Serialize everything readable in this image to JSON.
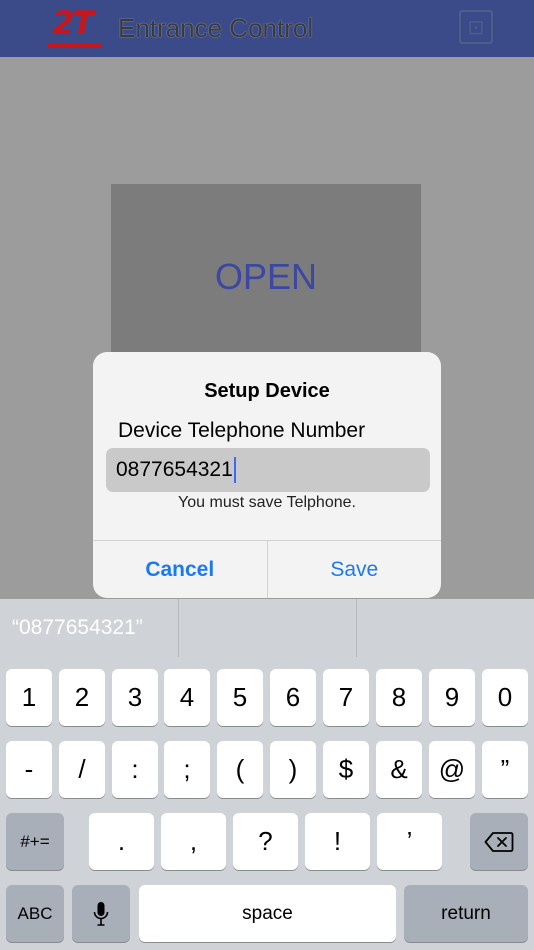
{
  "header": {
    "logo_text": "2T",
    "title": "Entrance Control",
    "settings_icon": "settings-icon"
  },
  "main": {
    "open_label": "OPEN"
  },
  "dialog": {
    "title": "Setup Device",
    "field_label": "Device Telephone Number",
    "field_value": "0877654321",
    "hint": "You must save Telphone.",
    "cancel_label": "Cancel",
    "save_label": "Save"
  },
  "keyboard": {
    "suggestions": [
      "“0877654321”",
      "",
      ""
    ],
    "row1": [
      "1",
      "2",
      "3",
      "4",
      "5",
      "6",
      "7",
      "8",
      "9",
      "0"
    ],
    "row2": [
      "-",
      "/",
      ":",
      ";",
      "(",
      ")",
      "$",
      "&",
      "@",
      "”"
    ],
    "row3": {
      "mode": "#+=",
      "keys": [
        ".",
        ",",
        "?",
        "!",
        "’"
      ],
      "delete_icon": "backspace-icon"
    },
    "row4": {
      "abc": "ABC",
      "mic_icon": "microphone-icon",
      "space": "space",
      "return": "return"
    }
  },
  "colors": {
    "header_bg": "#3b4b8a",
    "logo_red": "#c8161d",
    "open_text": "#3b47a0",
    "ios_blue": "#1a7af0"
  }
}
